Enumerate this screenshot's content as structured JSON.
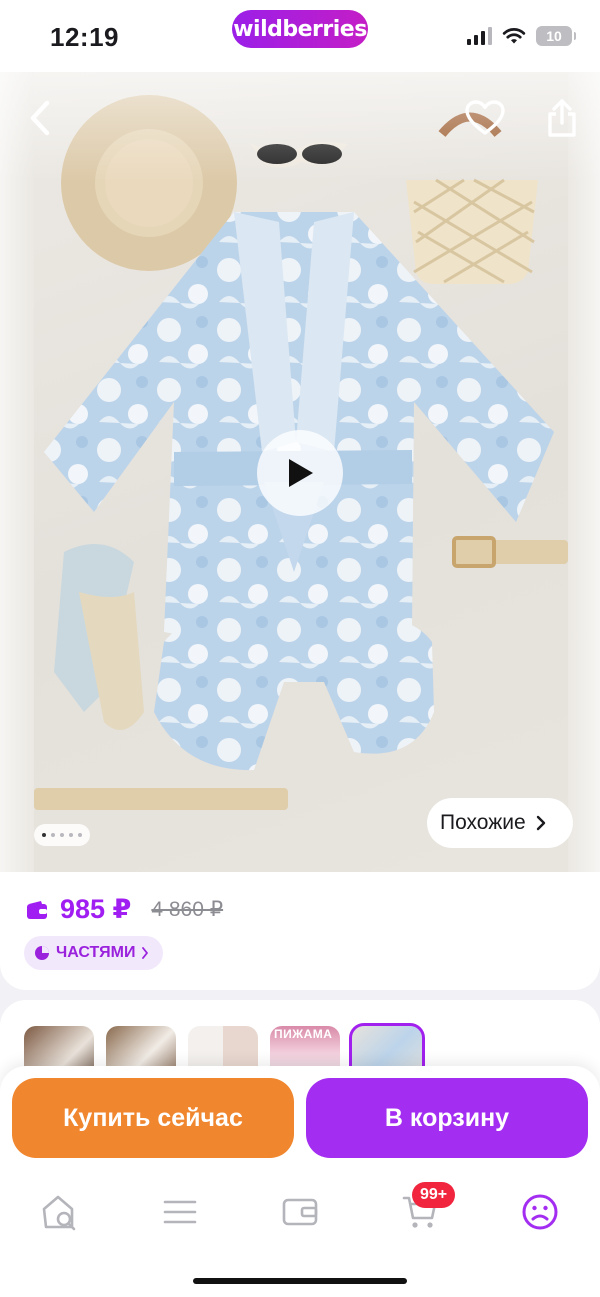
{
  "status_bar": {
    "time": "12:19",
    "brand": "wildberries",
    "battery": "10"
  },
  "photo": {
    "buttons": {
      "back_icon": "chevron-left-icon",
      "favorite_icon": "heart-icon",
      "share_icon": "share-icon",
      "play_icon": "play-icon"
    },
    "slides_total": 5,
    "slide_current": 1,
    "similar_label": "Похожие"
  },
  "price": {
    "current": "985 ₽",
    "old": "4 860 ₽",
    "installments_label": "ЧАСТЯМИ"
  },
  "thumbnails": [
    {
      "caption": "",
      "selected": false
    },
    {
      "caption": "",
      "selected": false
    },
    {
      "caption": "",
      "selected": false
    },
    {
      "caption": "ПИЖАМА",
      "selected": false
    },
    {
      "caption": "",
      "selected": true
    }
  ],
  "actions": {
    "buy_now": "Купить сейчас",
    "add_to_cart": "В корзину"
  },
  "tab_bar": {
    "items": [
      "home-search-icon",
      "menu-icon",
      "wallet-icon",
      "cart-icon",
      "profile-icon"
    ],
    "cart_badge": "99+"
  },
  "colors": {
    "brand": "#a32ef1",
    "buy_now": "#f0862e",
    "badge": "#f1263e"
  }
}
